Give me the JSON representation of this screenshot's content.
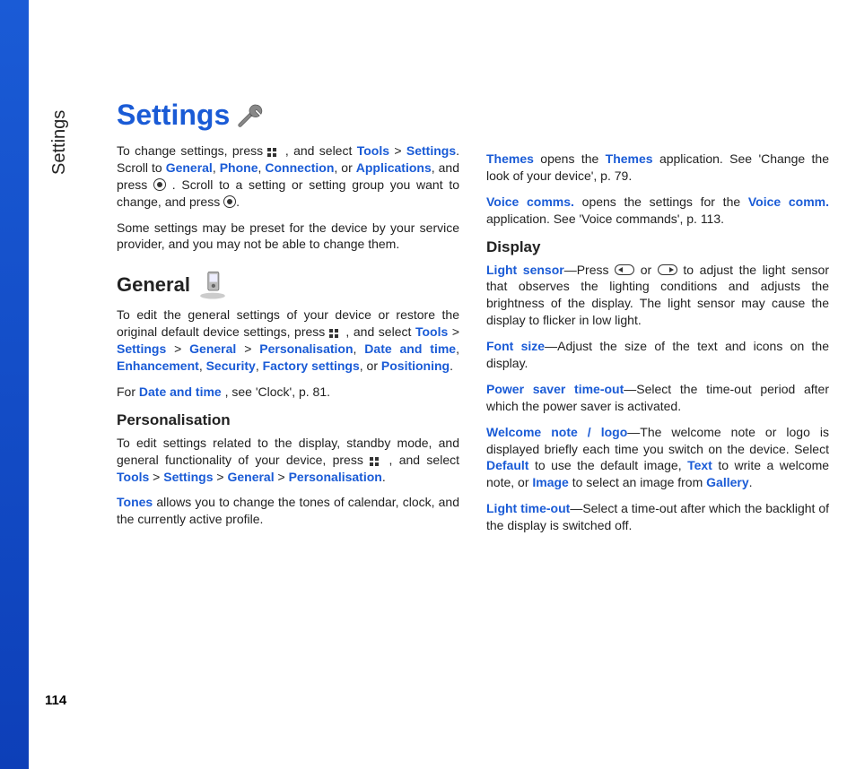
{
  "pageNumber": "114",
  "sideLabel": "Settings",
  "title": "Settings",
  "col1": {
    "p1a": "To change settings, press ",
    "p1b": ", and select ",
    "kTools": "Tools",
    "kSettings": "Settings",
    "p1c": "Scroll to ",
    "kGeneral": "General",
    "kPhone": "Phone",
    "kConnection": "Connection",
    "kApplications": "Applications",
    "p1d": "and press ",
    "p1e": ". Scroll to a setting or setting group you want to change, and press ",
    "p2": "Some settings may be preset for the device by your service provider, and you may not be able to change them.",
    "hGeneral": "General",
    "p3a": "To edit the general settings of your device or restore the original default device settings,  press ",
    "p3b": ", and select ",
    "kPersonalisation": "Personalisation",
    "kDateTime": "Date and time",
    "kEnhancement": "Enhancement",
    "kSecurity": "Security",
    "kFactory": "Factory settings",
    "kPositioning": "Positioning",
    "p4a": "For ",
    "p4b": ", see 'Clock', p.  81.",
    "hPersonalisation": "Personalisation",
    "p5a": "To edit settings related to the display, standby mode, and general functionality of your device, press ",
    "p5b": ", and select ",
    "kTones": "Tones",
    "p6": " allows you to change the tones of calendar, clock, and the currently active profile."
  },
  "col2": {
    "kThemes": "Themes",
    "p7a": " opens the ",
    "p7b": " application. See 'Change the look of your device', p. 79.",
    "kVoiceComms": "Voice comms.",
    "kVoiceComm": "Voice comm.",
    "p8a": " opens the settings for the ",
    "p8b": " application. See 'Voice commands', p. 113.",
    "hDisplay": "Display",
    "kLightSensor": "Light sensor",
    "p9a": "—Press ",
    "p9b": " or ",
    "p9c": " to adjust the light sensor that observes the lighting conditions and adjusts the brightness of the display. The light sensor may cause the display to flicker in low light.",
    "kFontSize": "Font size",
    "p10": "—Adjust the size of the text and icons on the display.",
    "kPowerSaver": "Power saver time-out",
    "p11": "—Select the time-out period after which the power saver is activated.",
    "kWelcome": "Welcome note / logo",
    "p12a": "—The welcome note or logo is displayed briefly each time you switch on the device. Select ",
    "kDefault": "Default",
    "p12b": " to use the default image, ",
    "kText": "Text",
    "p12c": " to write a welcome note, or ",
    "kImage": "Image",
    "p12d": " to select an image from ",
    "kGallery": "Gallery",
    "kLightTimeout": "Light time-out",
    "p13": "—Select a time-out after which the backlight of the display is switched off."
  }
}
